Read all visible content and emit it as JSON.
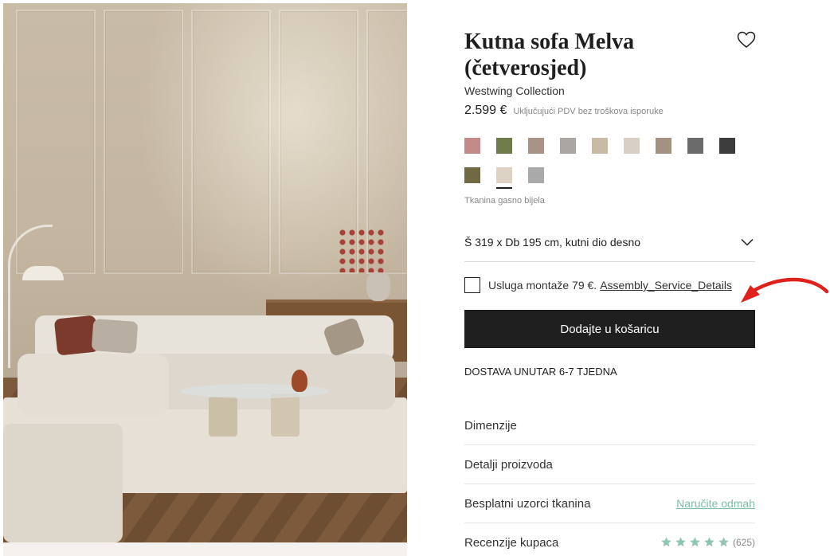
{
  "product": {
    "title": "Kutna sofa Melva (četverosjed)",
    "brand": "Westwing Collection",
    "price": "2.599 €",
    "price_note": "Uključujući PDV bez troškova isporuke"
  },
  "colors": {
    "swatches": [
      "#c48a8a",
      "#6f7b4a",
      "#a89486",
      "#aaa6a1",
      "#c9baa6",
      "#d8d0c4",
      "#a39282",
      "#6b6b6b",
      "#3c3c3c",
      "#6f6a45",
      "#ddd3c4",
      "#a9a9a9"
    ],
    "selected_index": 10,
    "selected_name": "Tkanina gasno bijela"
  },
  "size_select": {
    "value": "Š 319 x Db 195 cm, kutni dio desno",
    "icon": "chevron-down-icon"
  },
  "assembly": {
    "text": "Usluga montaže 79 €.",
    "link": "Assembly_Service_Details"
  },
  "cart": {
    "button_label": "Dodajte u košaricu"
  },
  "delivery": "DOSTAVA UNUTAR 6-7 TJEDNA",
  "accordion": {
    "dimensions": "Dimenzije",
    "details": "Detalji proizvoda",
    "samples": "Besplatni uzorci tkanina",
    "samples_link": "Naručite odmah",
    "reviews": "Recenzije kupaca",
    "rating": 5,
    "review_count": "(625)"
  },
  "accent_colors": {
    "button": "#1f1f1f",
    "link": "#7bbfab",
    "arrow": "#e0201b"
  }
}
